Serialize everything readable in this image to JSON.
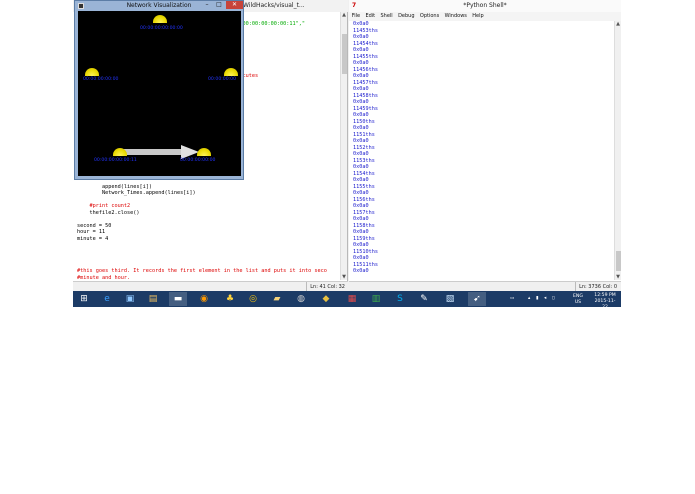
{
  "editor": {
    "title": "\\WildHacks/visual_t...",
    "status": "Ln: 41 Col: 32",
    "lines": [
      {
        "text": "                                        ,\"00:00:00\",\"00:00:00:00:00:11\",\"",
        "color": "green"
      },
      {
        "text": "",
        "color": "black"
      },
      {
        "text": "",
        "color": "black"
      },
      {
        "text": "",
        "color": "black"
      },
      {
        "text": "",
        "color": "black"
      },
      {
        "text": "",
        "color": "black"
      },
      {
        "text": "",
        "color": "black"
      },
      {
        "text": "",
        "color": "black"
      },
      {
        "text": "                                        mes. This executes",
        "color": "red"
      },
      {
        "text": "",
        "color": "black"
      },
      {
        "text": "",
        "color": "black"
      },
      {
        "text": "",
        "color": "black"
      },
      {
        "text": "",
        "color": "black"
      },
      {
        "text": "",
        "color": "black"
      },
      {
        "text": "",
        "color": "black"
      },
      {
        "text": "",
        "color": "black"
      },
      {
        "text": "",
        "color": "black"
      },
      {
        "text": "",
        "color": "black"
      },
      {
        "text": "",
        "color": "black"
      },
      {
        "text": "",
        "color": "black"
      },
      {
        "text": "                                        i])",
        "color": "black"
      },
      {
        "text": "",
        "color": "black"
      },
      {
        "text": "",
        "color": "black"
      },
      {
        "text": "",
        "color": "black"
      },
      {
        "text": "",
        "color": "black"
      },
      {
        "text": "        append(lines[i])",
        "color": "black"
      },
      {
        "text": "        Network_Times.append(lines[i])",
        "color": "black"
      },
      {
        "text": "",
        "color": "black"
      },
      {
        "text": "    #print count2",
        "color": "red"
      },
      {
        "text": "    thefile2.close()",
        "color": "black"
      },
      {
        "text": "",
        "color": "black"
      },
      {
        "text": "second = 50",
        "color": "black"
      },
      {
        "text": "hour = 11",
        "color": "black"
      },
      {
        "text": "minute = 4",
        "color": "black"
      },
      {
        "text": "",
        "color": "black"
      },
      {
        "text": "",
        "color": "black"
      },
      {
        "text": "",
        "color": "black"
      },
      {
        "text": "",
        "color": "black"
      },
      {
        "text": "#this goes third. It records the first element in the list and puts it into seco",
        "color": "red"
      },
      {
        "text": "#minute and hour.",
        "color": "red"
      }
    ]
  },
  "netviz": {
    "title": "Network Visualization",
    "nodes": [
      {
        "label": "00:00:00:00:00:00"
      },
      {
        "label": "00:00:00:00:00"
      },
      {
        "label": "00:00:00:00"
      },
      {
        "label": "00:00:00:00:00:11"
      },
      {
        "label": "00:00:00:00:00"
      }
    ]
  },
  "shell": {
    "title": "*Python Shell*",
    "menu": [
      "File",
      "Edit",
      "Shell",
      "Debug",
      "Options",
      "Windows",
      "Help"
    ],
    "status": "Ln: 3736 Col: 0",
    "output": [
      "0x0a0",
      "11453ths",
      "0x0a0",
      "11454ths",
      "0x0a0",
      "11455ths",
      "0x0a0",
      "11456ths",
      "0x0a0",
      "11457ths",
      "0x0a0",
      "11458ths",
      "0x0a0",
      "11459ths",
      "0x0a0",
      "1150ths",
      "0x0a0",
      "1151ths",
      "0x0a0",
      "1152ths",
      "0x0a0",
      "1153ths",
      "0x0a0",
      "1154ths",
      "0x0a0",
      "1155ths",
      "0x0a0",
      "1156ths",
      "0x0a0",
      "1157ths",
      "0x0a0",
      "1158ths",
      "0x0a0",
      "1159ths",
      "0x0a0",
      "11510ths",
      "0x0a0",
      "11511ths",
      "0x0a0"
    ]
  },
  "taskbar": {
    "items": [
      {
        "name": "start-button",
        "icon": "windows-logo-icon",
        "glyph": "⊞",
        "color": "#ffffff"
      },
      {
        "name": "taskbar-ie",
        "icon": "internet-explorer-icon",
        "glyph": "e",
        "color": "#3aa0ff"
      },
      {
        "name": "taskbar-computer",
        "icon": "computer-icon",
        "glyph": "▣",
        "color": "#8fc8ff"
      },
      {
        "name": "taskbar-photo",
        "icon": "photo-viewer-icon",
        "glyph": "▤",
        "color": "#f0c060"
      },
      {
        "name": "taskbar-terminal",
        "icon": "terminal-icon",
        "glyph": "▬",
        "color": "#ffffff"
      },
      {
        "name": "taskbar-media",
        "icon": "media-player-icon",
        "glyph": "◉",
        "color": "#ff9900"
      },
      {
        "name": "taskbar-python",
        "icon": "python-icon",
        "glyph": "♣",
        "color": "#ffd43b"
      },
      {
        "name": "taskbar-chrome",
        "icon": "chrome-icon",
        "glyph": "◎",
        "color": "#f4c20d"
      },
      {
        "name": "taskbar-explorer",
        "icon": "folder-icon",
        "glyph": "▰",
        "color": "#f5d37a"
      },
      {
        "name": "taskbar-search",
        "icon": "magnifier-icon",
        "glyph": "◍",
        "color": "#d0d0d0"
      },
      {
        "name": "taskbar-network",
        "icon": "network-icon",
        "glyph": "◆",
        "color": "#e8c040"
      },
      {
        "name": "taskbar-apps",
        "icon": "apps-icon",
        "glyph": "▦",
        "color": "#e34a4a"
      },
      {
        "name": "taskbar-excel",
        "icon": "spreadsheet-icon",
        "glyph": "▥",
        "color": "#3fae49"
      },
      {
        "name": "taskbar-skype",
        "icon": "skype-icon",
        "glyph": "S",
        "color": "#00aff0"
      },
      {
        "name": "taskbar-idle",
        "icon": "idle-editor-icon",
        "glyph": "✎",
        "color": "#ffffff"
      },
      {
        "name": "taskbar-notes",
        "icon": "notes-icon",
        "glyph": "▧",
        "color": "#cfe8ff"
      },
      {
        "name": "taskbar-pyshell",
        "icon": "python-shell-icon",
        "glyph": "➹",
        "color": "#ffffff"
      }
    ],
    "tray_lang": "ENG",
    "tray_region": "US",
    "time": "12:59 PM",
    "date": "2015-11-22"
  }
}
